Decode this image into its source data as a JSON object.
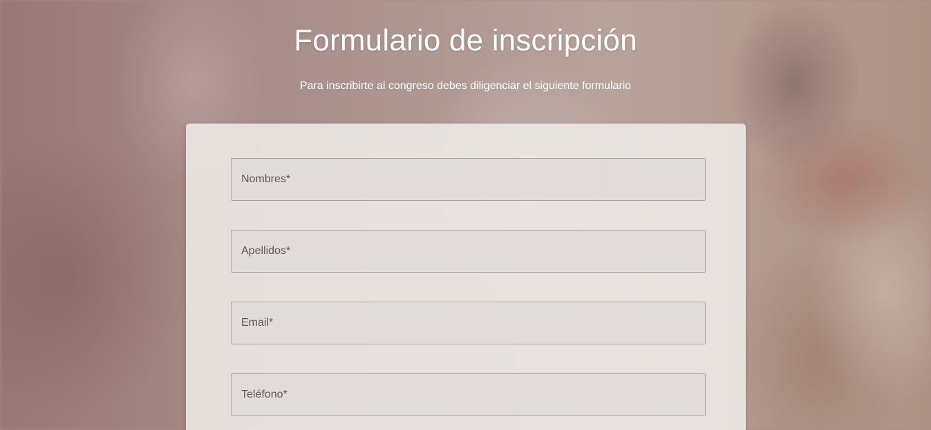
{
  "header": {
    "title": "Formulario de inscripción",
    "subtitle": "Para inscribirte al congreso debes diligenciar el siguiente formulario"
  },
  "form": {
    "fields": [
      {
        "placeholder": "Nombres*",
        "value": ""
      },
      {
        "placeholder": "Apellidos*",
        "value": ""
      },
      {
        "placeholder": "Email*",
        "value": ""
      },
      {
        "placeholder": "Teléfono*",
        "value": ""
      }
    ]
  }
}
